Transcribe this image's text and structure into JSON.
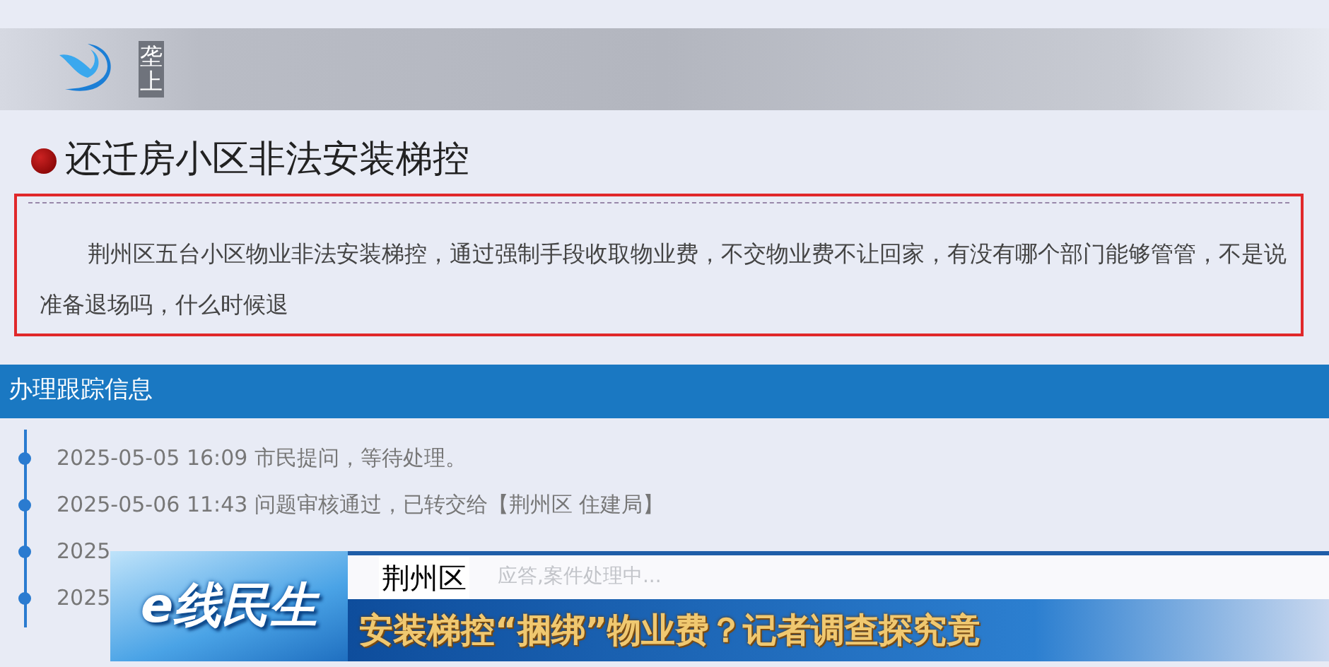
{
  "header": {
    "site_mark": "垄上"
  },
  "question": {
    "title": "还迁房小区非法安装梯控",
    "body": "荆州区五台小区物业非法安装梯控，通过强制手段收取物业费，不交物业费不让回家，有没有哪个部门能够管管，不是说准备退场吗，什么时候退",
    "highlighted": true
  },
  "tracking": {
    "heading": "办理跟踪信息",
    "items": [
      {
        "text": "2025-05-05 16:09 市民提问，等待处理。"
      },
      {
        "text": "2025-05-06 11:43 问题审核通过，已转交给【荆州区 住建局】"
      },
      {
        "text": "2025"
      },
      {
        "text": "2025"
      }
    ]
  },
  "caption": {
    "show_logo": "e线民生",
    "location": "荆州区",
    "faded_text": "应答,案件处理中...",
    "headline": "安装梯控“捆绑”物业费？记者调查探究竟"
  }
}
